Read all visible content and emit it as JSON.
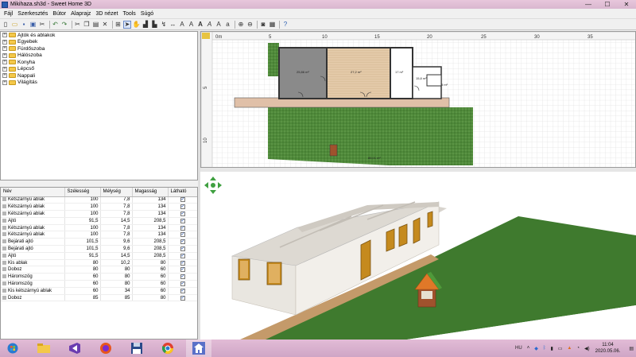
{
  "window": {
    "title": "Mikihaza.sh3d - Sweet Home 3D",
    "minimize": "—",
    "maximize": "☐",
    "close": "✕"
  },
  "menu": [
    "Fájl",
    "Szerkesztés",
    "Bútor",
    "Alaprajz",
    "3D nézet",
    "Tools",
    "Súgó"
  ],
  "toolbar_icons": [
    "new-file-icon",
    "open-icon",
    "save-icon",
    "save-as-icon",
    "cut-icon",
    "undo-icon",
    "redo-icon",
    "cut2-icon",
    "copy-icon",
    "paste-icon",
    "delete-icon",
    "add-furniture-icon",
    "select-arrow-icon",
    "pan-hand-icon",
    "create-walls-icon",
    "create-rooms-icon",
    "create-polylines-icon",
    "create-dimensions-icon",
    "create-labels-icon",
    "text-style-icon",
    "bold-icon",
    "italic-icon",
    "increase-text-icon",
    "decrease-text-icon",
    "zoom-in-icon",
    "zoom-out-icon",
    "photo-icon",
    "video-icon",
    "help-icon"
  ],
  "catalog": {
    "items": [
      {
        "label": "Ajtók és ablakok"
      },
      {
        "label": "Egyebek"
      },
      {
        "label": "Fürdőszoba"
      },
      {
        "label": "Hálószoba"
      },
      {
        "label": "Konyha"
      },
      {
        "label": "Lépcső"
      },
      {
        "label": "Nappali"
      },
      {
        "label": "Világítás"
      }
    ]
  },
  "furniture": {
    "headers": [
      "Név",
      "Szélesség",
      "Mélység",
      "Magasság",
      "Látható"
    ],
    "rows": [
      {
        "name": "Kétszárnyú ablak",
        "width": "100",
        "depth": "7,8",
        "height": "134",
        "visible": true
      },
      {
        "name": "Kétszárnyú ablak",
        "width": "100",
        "depth": "7,8",
        "height": "134",
        "visible": true
      },
      {
        "name": "Kétszárnyú ablak",
        "width": "100",
        "depth": "7,8",
        "height": "134",
        "visible": true
      },
      {
        "name": "Ajtó",
        "width": "91,5",
        "depth": "14,5",
        "height": "208,5",
        "visible": true
      },
      {
        "name": "Kétszárnyú ablak",
        "width": "100",
        "depth": "7,8",
        "height": "134",
        "visible": true
      },
      {
        "name": "Kétszárnyú ablak",
        "width": "100",
        "depth": "7,8",
        "height": "134",
        "visible": true
      },
      {
        "name": "Bejárati ajtó",
        "width": "101,5",
        "depth": "9,6",
        "height": "208,5",
        "visible": true
      },
      {
        "name": "Bejárati ajtó",
        "width": "101,5",
        "depth": "9,6",
        "height": "208,5",
        "visible": true
      },
      {
        "name": "Ajtó",
        "width": "91,5",
        "depth": "14,5",
        "height": "208,5",
        "visible": true
      },
      {
        "name": "Kis ablak",
        "width": "80",
        "depth": "10,2",
        "height": "80",
        "visible": true
      },
      {
        "name": "Doboz",
        "width": "80",
        "depth": "80",
        "height": "60",
        "visible": true
      },
      {
        "name": "Háromszög",
        "width": "60",
        "depth": "80",
        "height": "60",
        "visible": true
      },
      {
        "name": "Háromszög",
        "width": "60",
        "depth": "80",
        "height": "60",
        "visible": true
      },
      {
        "name": "Kis kétszárnyú ablak",
        "width": "60",
        "depth": "34",
        "height": "60",
        "visible": true
      },
      {
        "name": "Doboz",
        "width": "85",
        "depth": "85",
        "height": "80",
        "visible": true
      }
    ]
  },
  "plan": {
    "ruler_labels": [
      "0m",
      "5",
      "10",
      "15",
      "20",
      "25",
      "30",
      "35"
    ],
    "ruler_v_labels": [
      "5",
      "10"
    ],
    "room_labels": [
      "25,86 m²",
      "27,2 m²",
      "17 m²",
      "15,8 m²",
      "5 m²",
      "85,01 m²"
    ]
  },
  "taskbar": {
    "language": "HU",
    "time": "11:04",
    "date": "2020.05.06."
  },
  "colors": {
    "grass": "#3f7a2e",
    "wall": "#e9e6e0",
    "door": "#c58a1e",
    "path": "#c49a6a",
    "plan_floor_wood": "#e3c9a8",
    "plan_floor_gray": "#8a8a8a"
  }
}
